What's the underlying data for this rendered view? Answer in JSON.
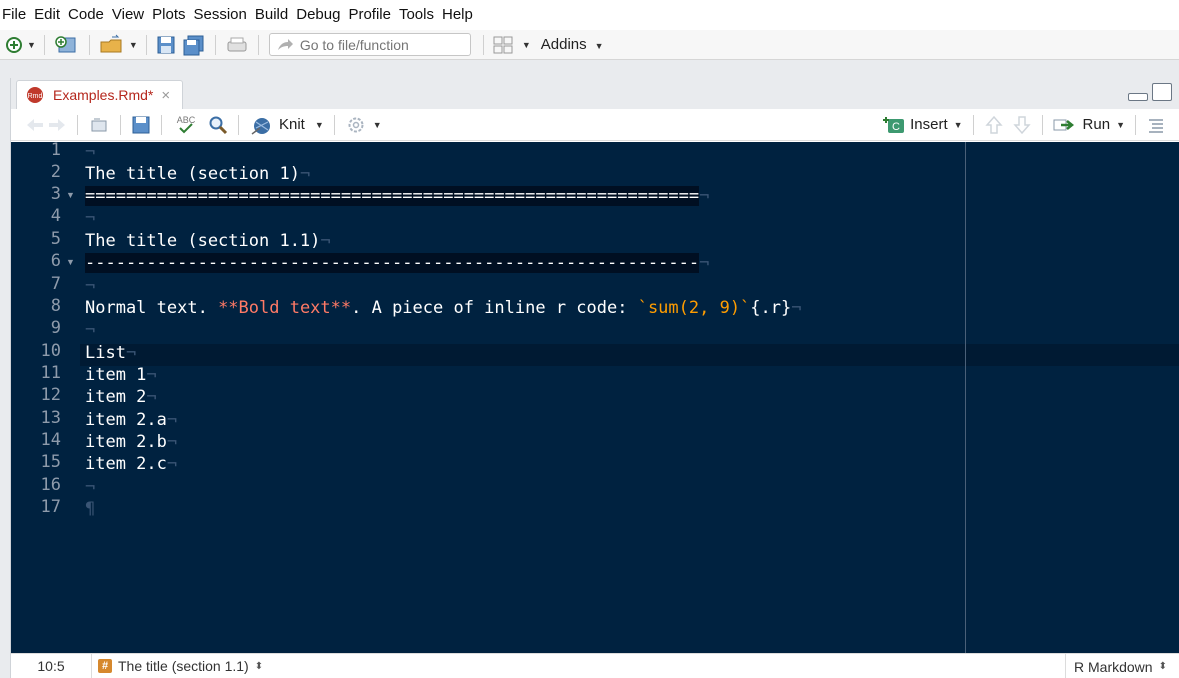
{
  "menu": [
    "File",
    "Edit",
    "Code",
    "View",
    "Plots",
    "Session",
    "Build",
    "Debug",
    "Profile",
    "Tools",
    "Help"
  ],
  "toolbar": {
    "goto_placeholder": "Go to file/function",
    "addins_label": "Addins"
  },
  "editor_tab": {
    "label": "Examples.Rmd*",
    "close": "×",
    "file_icon_text": "Rmd"
  },
  "editor_toolbar": {
    "spell_label": "ABC",
    "knit_label": "Knit",
    "insert_label": "Insert",
    "insert_badge": "C",
    "run_label": "Run"
  },
  "editor": {
    "line_numbers": [
      "1",
      "2",
      "3",
      "4",
      "5",
      "6",
      "7",
      "8",
      "9",
      "10",
      "11",
      "12",
      "13",
      "14",
      "15",
      "16",
      "17"
    ],
    "lines": {
      "l2": "The title (section 1)",
      "l3": "============================================================",
      "l5": "The title (section 1.1)",
      "l6": "------------------------------------------------------------",
      "l8_a": "Normal text. ",
      "l8_bold": "**Bold text**",
      "l8_b": ". A piece of inline r code: ",
      "l8_code": "`sum(2, 9)`",
      "l8_c": "{.r}",
      "l10": "List",
      "l11": "item 1",
      "l12": "item 2",
      "l13": "item 2.a",
      "l14": "item 2.b",
      "l15": "item 2.c"
    },
    "eol_mark": "¬",
    "eof_mark": "¶",
    "colors": {
      "background": "#002240",
      "text": "#ffffff",
      "bold_markup": "#ff7a66",
      "inline_code": "#ff9d00",
      "invisibles": "#3a5575"
    }
  },
  "status": {
    "position": "10:5",
    "section_icon": "#",
    "section": "The title (section 1.1)",
    "filetype": "R Markdown"
  }
}
